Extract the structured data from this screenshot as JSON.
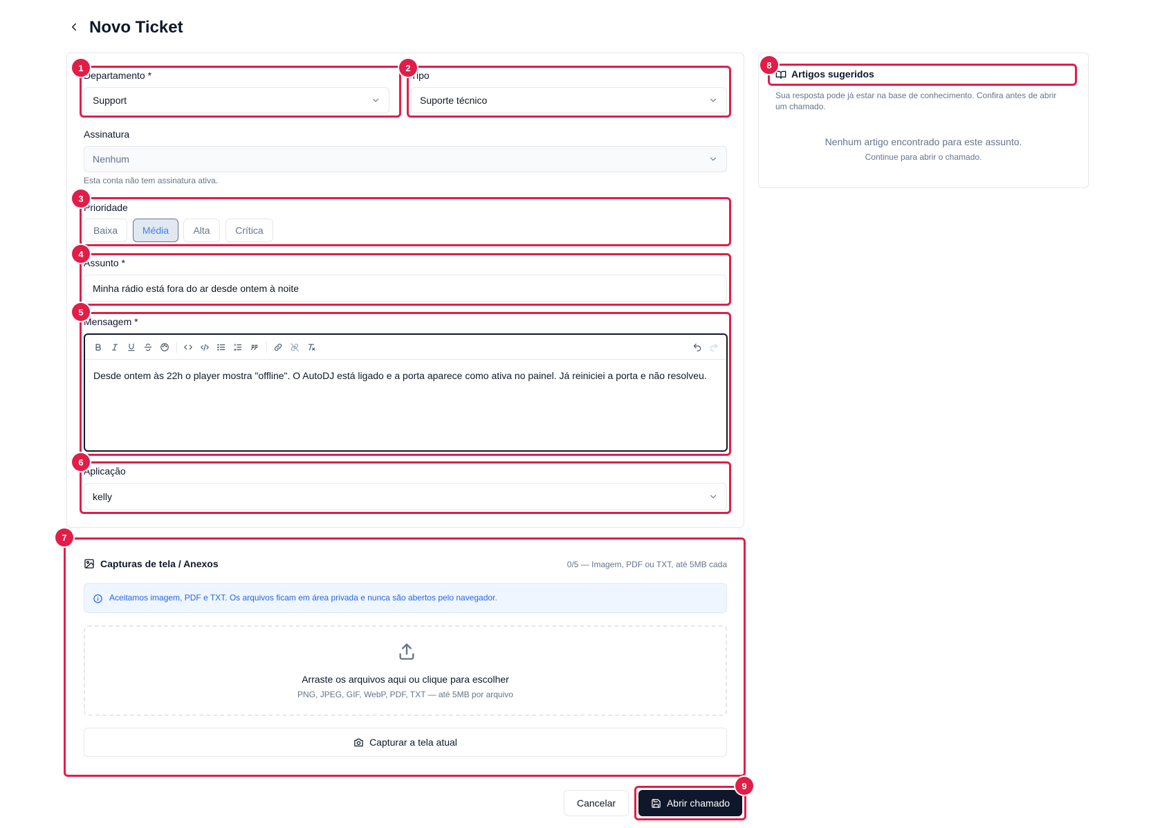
{
  "header": {
    "title": "Novo Ticket"
  },
  "form": {
    "department": {
      "label": "Departamento *",
      "value": "Support"
    },
    "type": {
      "label": "Tipo",
      "value": "Suporte técnico"
    },
    "signature": {
      "label": "Assinatura",
      "value": "Nenhum",
      "hint": "Esta conta não tem assinatura ativa."
    },
    "priority": {
      "label": "Prioridade",
      "options": [
        "Baixa",
        "Média",
        "Alta",
        "Crítica"
      ],
      "selected": "Média"
    },
    "subject": {
      "label": "Assunto *",
      "value": "Minha rádio está fora do ar desde ontem à noite"
    },
    "message": {
      "label": "Mensagem *",
      "value": "Desde ontem às 22h o player mostra \"offline\". O AutoDJ está ligado e a porta aparece como ativa no painel. Já reiniciei a porta e não resolveu."
    },
    "application": {
      "label": "Aplicação",
      "value": "kelly"
    }
  },
  "attachments": {
    "title": "Capturas de tela / Anexos",
    "counter": "0/5 — Imagem, PDF ou TXT, até 5MB cada",
    "info": "Aceitamos imagem, PDF e TXT. Os arquivos ficam em área privada e nunca são abertos pelo navegador.",
    "dropzone_title": "Arraste os arquivos aqui ou clique para escolher",
    "dropzone_hint": "PNG, JPEG, GIF, WebP, PDF, TXT — até 5MB por arquivo",
    "capture_label": "Capturar a tela atual"
  },
  "sidebar": {
    "title": "Artigos sugeridos",
    "description_line1": "Sua resposta pode já estar na base de conhecimento. Confira antes de abrir",
    "description_line2": "um chamado.",
    "empty_title": "Nenhum artigo encontrado para este assunto.",
    "empty_hint": "Continue para abrir o chamado."
  },
  "footer": {
    "cancel_label": "Cancelar",
    "submit_label": "Abrir chamado"
  },
  "annotations": [
    "1",
    "2",
    "3",
    "4",
    "5",
    "6",
    "7",
    "8",
    "9"
  ],
  "colors": {
    "annotation": "#e11d48",
    "primary": "#0f172a",
    "accent": "#3b82f6"
  }
}
